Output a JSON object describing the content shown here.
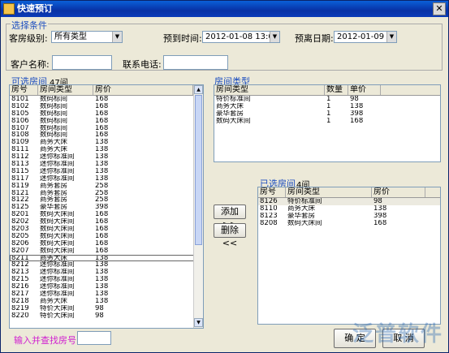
{
  "window": {
    "title": "快速预订"
  },
  "conditions": {
    "section_label": "选择条件",
    "room_level_label": "客房级别:",
    "room_level_value": "所有类型",
    "arrive_label": "预到时间:",
    "arrive_value": "2012-01-08 13:03:04",
    "leave_label": "预离日期:",
    "leave_value": "2012-01-09",
    "customer_label": "客户名称:",
    "phone_label": "联系电话:"
  },
  "available": {
    "section_label": "可选房间",
    "count": "47间",
    "columns": [
      "房号",
      "房间类型",
      "房价"
    ],
    "rows": [
      [
        "8101",
        "数码标间",
        "168"
      ],
      [
        "8102",
        "数码标间",
        "168"
      ],
      [
        "8105",
        "数码标间",
        "168"
      ],
      [
        "8106",
        "数码标间",
        "168"
      ],
      [
        "8107",
        "数码标间",
        "168"
      ],
      [
        "8108",
        "数码标间",
        "168"
      ],
      [
        "8109",
        "商务大床",
        "138"
      ],
      [
        "8111",
        "商务大床",
        "138"
      ],
      [
        "8112",
        "迷你标准间",
        "138"
      ],
      [
        "8113",
        "迷你标准间",
        "138"
      ],
      [
        "8115",
        "迷你标准间",
        "138"
      ],
      [
        "8117",
        "迷你标准间",
        "138"
      ],
      [
        "8119",
        "商务套房",
        "258"
      ],
      [
        "8121",
        "商务套房",
        "258"
      ],
      [
        "8122",
        "商务套房",
        "258"
      ],
      [
        "8125",
        "豪华套房",
        "398"
      ],
      [
        "8201",
        "数码大床间",
        "168"
      ],
      [
        "8202",
        "数码大床间",
        "168"
      ],
      [
        "8203",
        "数码大床间",
        "168"
      ],
      [
        "8205",
        "数码大床间",
        "168"
      ],
      [
        "8206",
        "数码大床间",
        "168"
      ],
      [
        "8207",
        "数码大床间",
        "168"
      ],
      [
        "8211",
        "商务大床",
        "138"
      ],
      [
        "8212",
        "迷你标准间",
        "138"
      ],
      [
        "8213",
        "迷你标准间",
        "138"
      ],
      [
        "8215",
        "迷你标准间",
        "138"
      ],
      [
        "8216",
        "迷你标准间",
        "138"
      ],
      [
        "8217",
        "迷你标准间",
        "138"
      ],
      [
        "8218",
        "商务大床",
        "138"
      ],
      [
        "8219",
        "特价大床间",
        "98"
      ],
      [
        "8220",
        "特价大床间",
        "98"
      ]
    ]
  },
  "room_types": {
    "section_label": "房间类型",
    "columns": [
      "房间类型",
      "数量",
      "单价"
    ],
    "rows": [
      [
        "特价标准间",
        "1",
        "98"
      ],
      [
        "商务大床",
        "1",
        "138"
      ],
      [
        "豪华套房",
        "1",
        "398"
      ],
      [
        "数码大床间",
        "1",
        "168"
      ]
    ]
  },
  "selected": {
    "section_label": "已选房间",
    "count": "4间",
    "columns": [
      "房号",
      "房间类型",
      "房价"
    ],
    "rows": [
      [
        "8126",
        "特价标准间",
        "98"
      ],
      [
        "8110",
        "商务大床",
        "138"
      ],
      [
        "8123",
        "豪华套房",
        "398"
      ],
      [
        "8208",
        "数码大床间",
        "168"
      ]
    ]
  },
  "buttons": {
    "add": "添加 >>",
    "remove": "删除 <<",
    "ok": "确 定",
    "cancel": "取 消"
  },
  "search": {
    "label": "输入并查找房号:"
  },
  "watermark": {
    "text": "泛普软件"
  },
  "icons": {
    "title": "window-icon",
    "close": "close-icon"
  }
}
